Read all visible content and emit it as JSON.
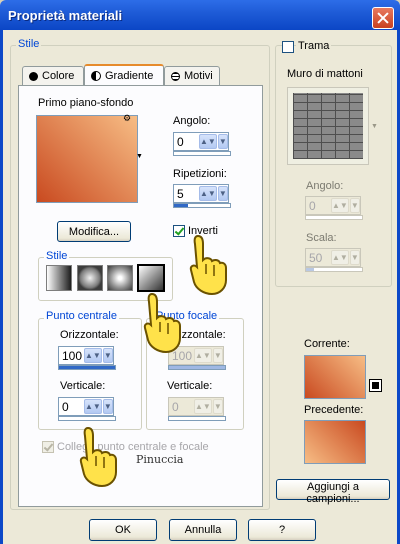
{
  "window": {
    "title": "Proprietà materiali"
  },
  "stile_group": {
    "label": "Stile"
  },
  "tabs": [
    {
      "label": "Colore",
      "icon": "circle-icon"
    },
    {
      "label": "Gradiente",
      "icon": "half-circle-icon"
    },
    {
      "label": "Motivi",
      "icon": "pattern-icon"
    }
  ],
  "gradient": {
    "preview_label": "Primo piano-sfondo",
    "colors": [
      "#c94a20",
      "#f7bd85"
    ],
    "modify_button": "Modifica...",
    "angle_label": "Angolo:",
    "angle_value": "0",
    "repeat_label": "Ripetizioni:",
    "repeat_value": "5",
    "invert_label": "Inverti",
    "invert_checked": true,
    "style_group_label": "Stile",
    "style_buttons": [
      "linear-style",
      "rectangular-style",
      "sunburst-style",
      "radial-style"
    ]
  },
  "center_point": {
    "label": "Punto centrale",
    "h_label": "Orizzontale:",
    "h_value": "100",
    "v_label": "Verticale:",
    "v_value": "0"
  },
  "focal_point": {
    "label": "Punto focale",
    "h_label": "Orizzontale:",
    "h_value": "100",
    "v_label": "Verticale:",
    "v_value": "0"
  },
  "link_points": {
    "label": "Collega punto centrale e focale",
    "checked": true
  },
  "watermark": "Pinuccia",
  "texture": {
    "trama_label": "Trama",
    "name": "Muro di mattoni",
    "angle_label": "Angolo:",
    "angle_value": "0",
    "scale_label": "Scala:",
    "scale_value": "50"
  },
  "current": {
    "label": "Corrente:"
  },
  "previous": {
    "label": "Precedente:"
  },
  "add_swatch_button": "Aggiungi a campioni...",
  "footer": {
    "ok": "OK",
    "cancel": "Annulla",
    "help": "?"
  }
}
